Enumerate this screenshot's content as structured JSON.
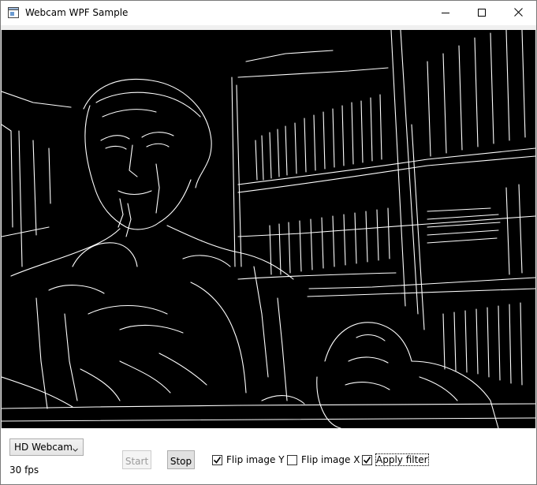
{
  "window": {
    "title": "Webcam WPF Sample"
  },
  "icons": {
    "app": "app-window-icon",
    "minimize": "minimize-icon",
    "maximize": "maximize-icon",
    "close": "close-icon",
    "dropdown": "chevron-down-icon",
    "checkmark": "checkmark-icon"
  },
  "video": {
    "description_colors": {
      "background": "#000000",
      "edges": "#ffffff"
    }
  },
  "controls": {
    "camera_select": {
      "value": "HD Webcam"
    },
    "fps_label": "30 fps",
    "start_label": "Start",
    "stop_label": "Stop",
    "start_enabled": false,
    "stop_enabled": true,
    "flip_y": {
      "label": "Flip image Y",
      "checked": true
    },
    "flip_x": {
      "label": "Flip image X",
      "checked": false
    },
    "apply_filter": {
      "label": "Apply filter",
      "checked": true,
      "focused": true
    }
  }
}
